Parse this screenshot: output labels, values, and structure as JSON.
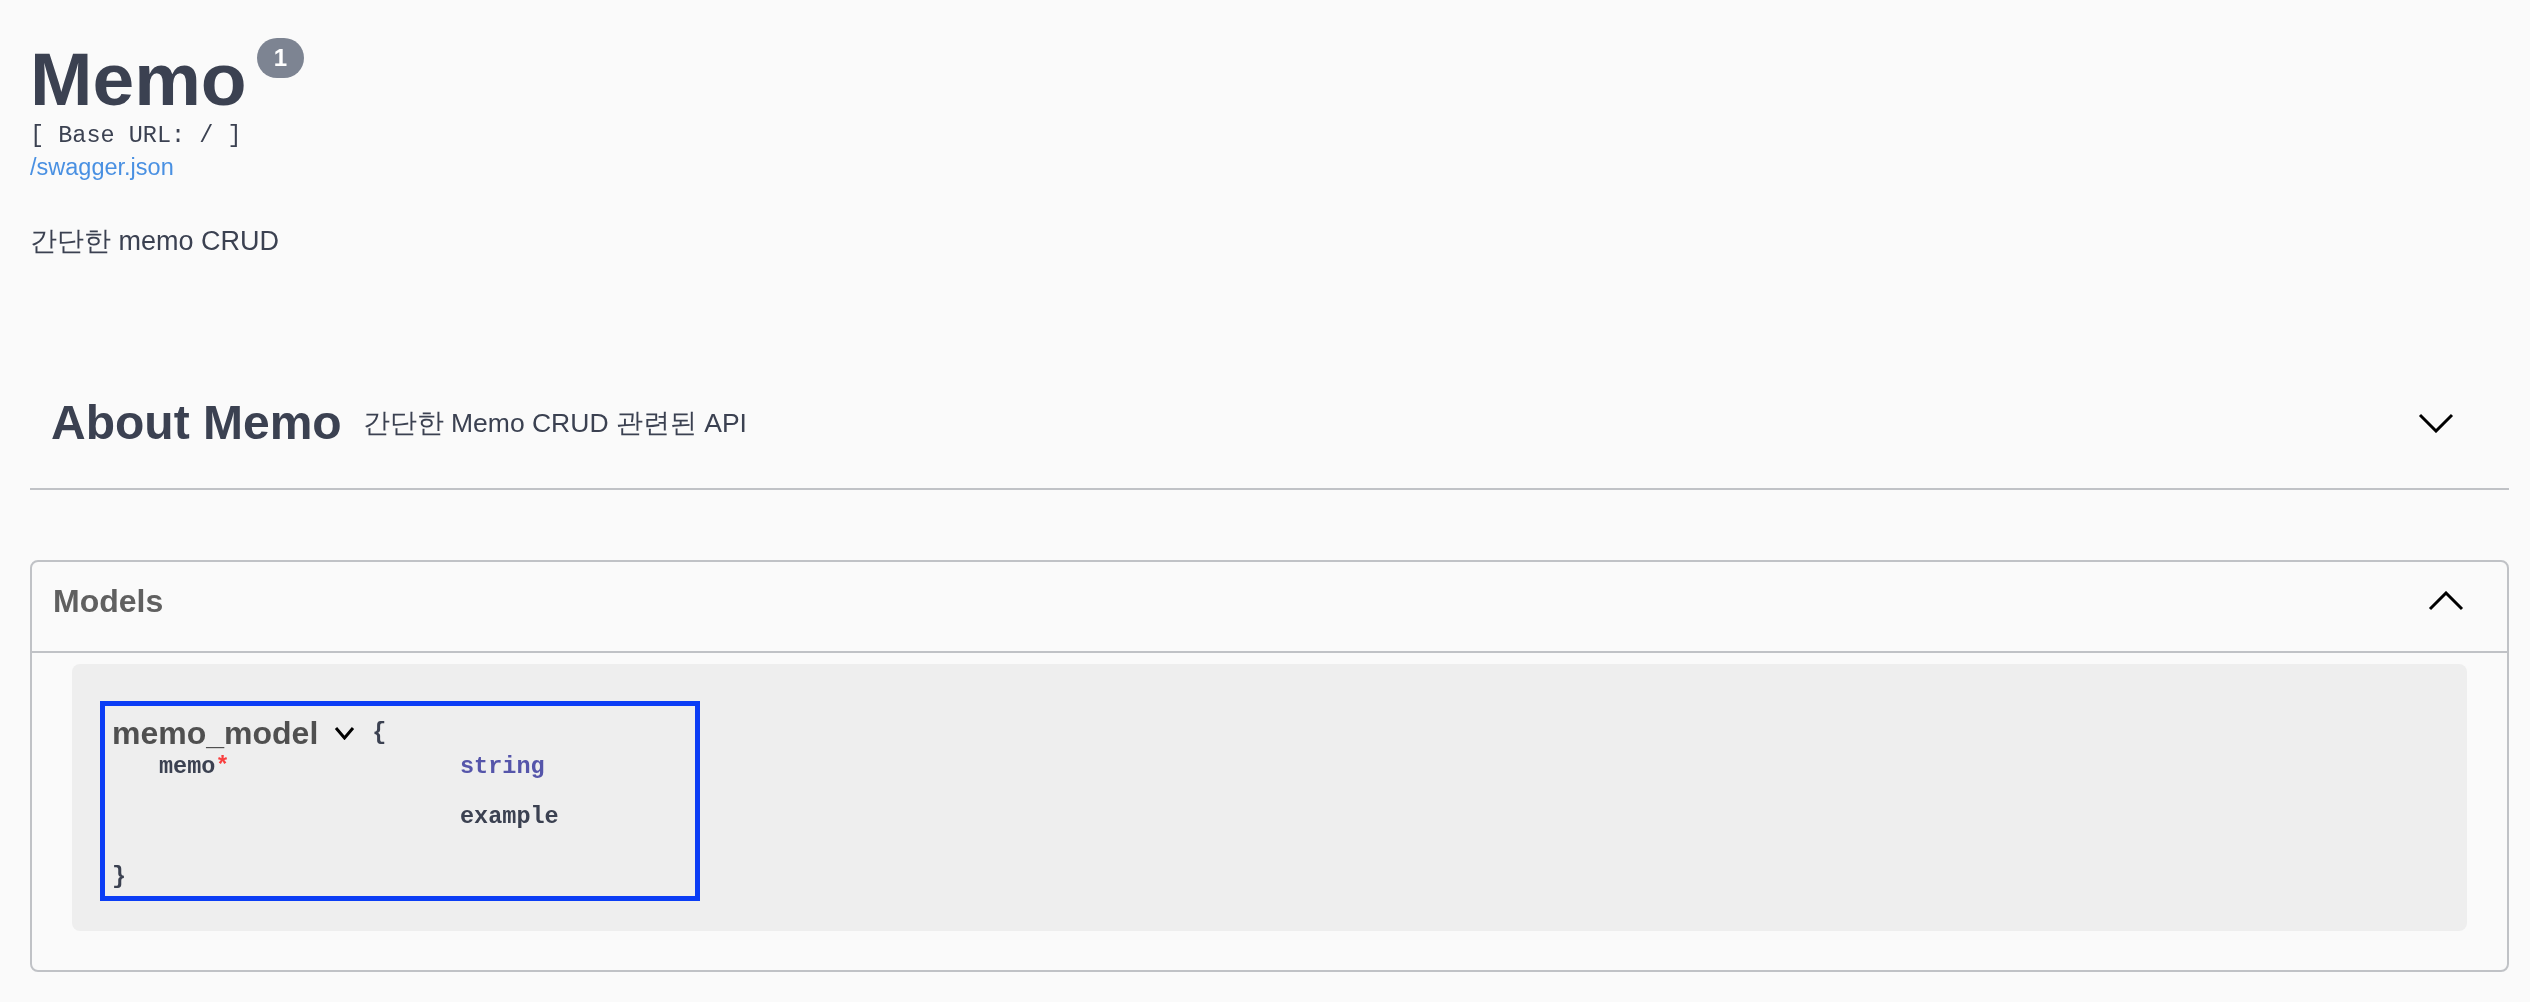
{
  "info": {
    "title": "Memo",
    "version": "1",
    "base_url": "[ Base URL: / ]",
    "spec_link": "/swagger.json",
    "description": "간단한 memo CRUD"
  },
  "tags": [
    {
      "name": "About Memo",
      "description": "간단한 Memo CRUD 관련된 API",
      "expanded": false
    }
  ],
  "models_section": {
    "title": "Models",
    "expanded": true,
    "models": [
      {
        "name": "memo_model",
        "expanded": true,
        "focused": true,
        "open_brace": "{",
        "close_brace": "}",
        "properties": [
          {
            "name": "memo",
            "required_mark": "*",
            "type": "string",
            "example_label": "example"
          }
        ]
      }
    ]
  }
}
